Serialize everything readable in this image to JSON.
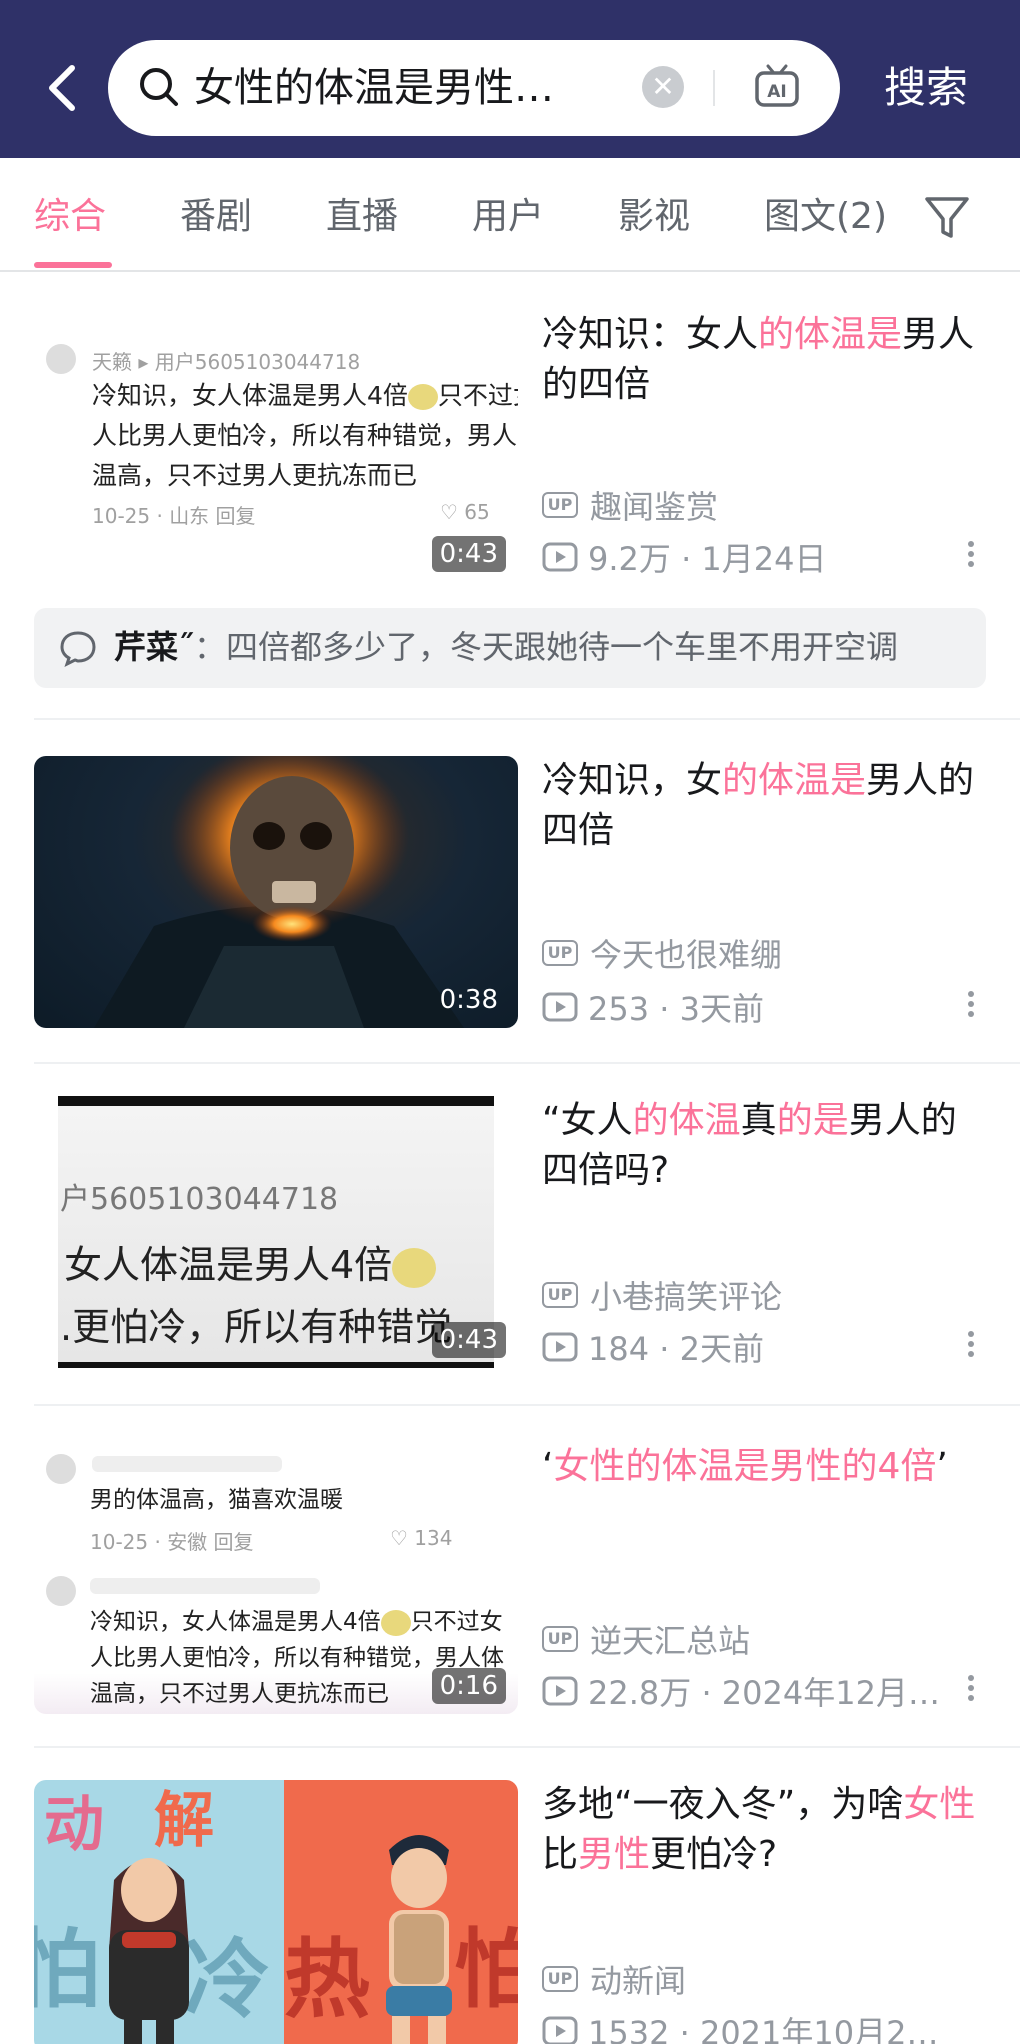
{
  "search": {
    "query": "女性的体温是男性…",
    "submit_label": "搜索",
    "ai_label": "AI"
  },
  "tabs": [
    {
      "label": "综合",
      "active": true
    },
    {
      "label": "番剧",
      "active": false
    },
    {
      "label": "直播",
      "active": false
    },
    {
      "label": "用户",
      "active": false
    },
    {
      "label": "影视",
      "active": false
    },
    {
      "label": "图文(2)",
      "active": false
    }
  ],
  "accent_color": "#fb7299",
  "header_color": "#2f3168",
  "results": [
    {
      "title_parts": [
        {
          "text": "冷知识：女人",
          "hl": false
        },
        {
          "text": "的体温是",
          "hl": true
        },
        {
          "text": "男人的四倍",
          "hl": false
        }
      ],
      "uploader": "趣闻鉴赏",
      "views": "9.2万",
      "date": "1月24日",
      "duration": "0:43",
      "thumb": {
        "user_line": "天籁 ▸ 用户5605103044718",
        "lines": [
          "冷知识，女人体温是男人4倍",
          "只不过女",
          "人比男人更怕冷，所以有种错觉，男人",
          "温高，只不过男人更抗冻而已"
        ],
        "meta": "10-25 · 山东    回复",
        "likes": "65"
      },
      "hot_comment": {
        "author": "芹菜˝",
        "text": "：四倍都多少了，冬天跟她待一个车里不用开空调"
      }
    },
    {
      "title_parts": [
        {
          "text": "冷知识，女",
          "hl": false
        },
        {
          "text": "的体温是",
          "hl": true
        },
        {
          "text": "男人的四倍",
          "hl": false
        }
      ],
      "uploader": "今天也很难绷",
      "views": "253",
      "date": "3天前",
      "duration": "0:38"
    },
    {
      "title_parts": [
        {
          "text": "“女人",
          "hl": false
        },
        {
          "text": "的体温",
          "hl": true
        },
        {
          "text": "真",
          "hl": false
        },
        {
          "text": "的是",
          "hl": true
        },
        {
          "text": "男人的四倍吗?",
          "hl": false
        }
      ],
      "uploader": "小巷搞笑评论",
      "views": "184",
      "date": "2天前",
      "duration": "0:43",
      "thumb": {
        "line1": "户5605103044718",
        "line2": "女人体温是男人4倍",
        "line3": ".更怕冷，所以有种错觉"
      }
    },
    {
      "title_parts": [
        {
          "text": "‘",
          "hl": false
        },
        {
          "text": "女性的体温是男性的4倍",
          "hl": true
        },
        {
          "text": "’",
          "hl": false
        }
      ],
      "uploader": "逆天汇总站",
      "views": "22.8万",
      "date": "2024年12月…",
      "duration": "0:16",
      "thumb": {
        "line_a": "男的体温高，猫喜欢温暖",
        "meta_a": "10-25 · 安徽    回复",
        "likes_a": "134",
        "lines_b": [
          "冷知识，女人体温是男人4倍",
          "只不过女",
          "人比男人更怕冷，所以有种错觉，男人体",
          "温高，只不过男人更抗冻而已"
        ]
      }
    },
    {
      "title_parts": [
        {
          "text": "多地“一夜入冬”，为啥",
          "hl": false
        },
        {
          "text": "女性",
          "hl": true
        },
        {
          "text": "比",
          "hl": false
        },
        {
          "text": "男性",
          "hl": true
        },
        {
          "text": "更怕冷?",
          "hl": false
        }
      ],
      "uploader": "动新闻",
      "views": "1532",
      "date": "2021年10月2…",
      "thumb": {
        "chars_left": "动",
        "chars_left2": "解",
        "char_cold": "冷",
        "char_hot": "热",
        "char_fear1": "怕",
        "char_fear2": "怕"
      }
    }
  ]
}
